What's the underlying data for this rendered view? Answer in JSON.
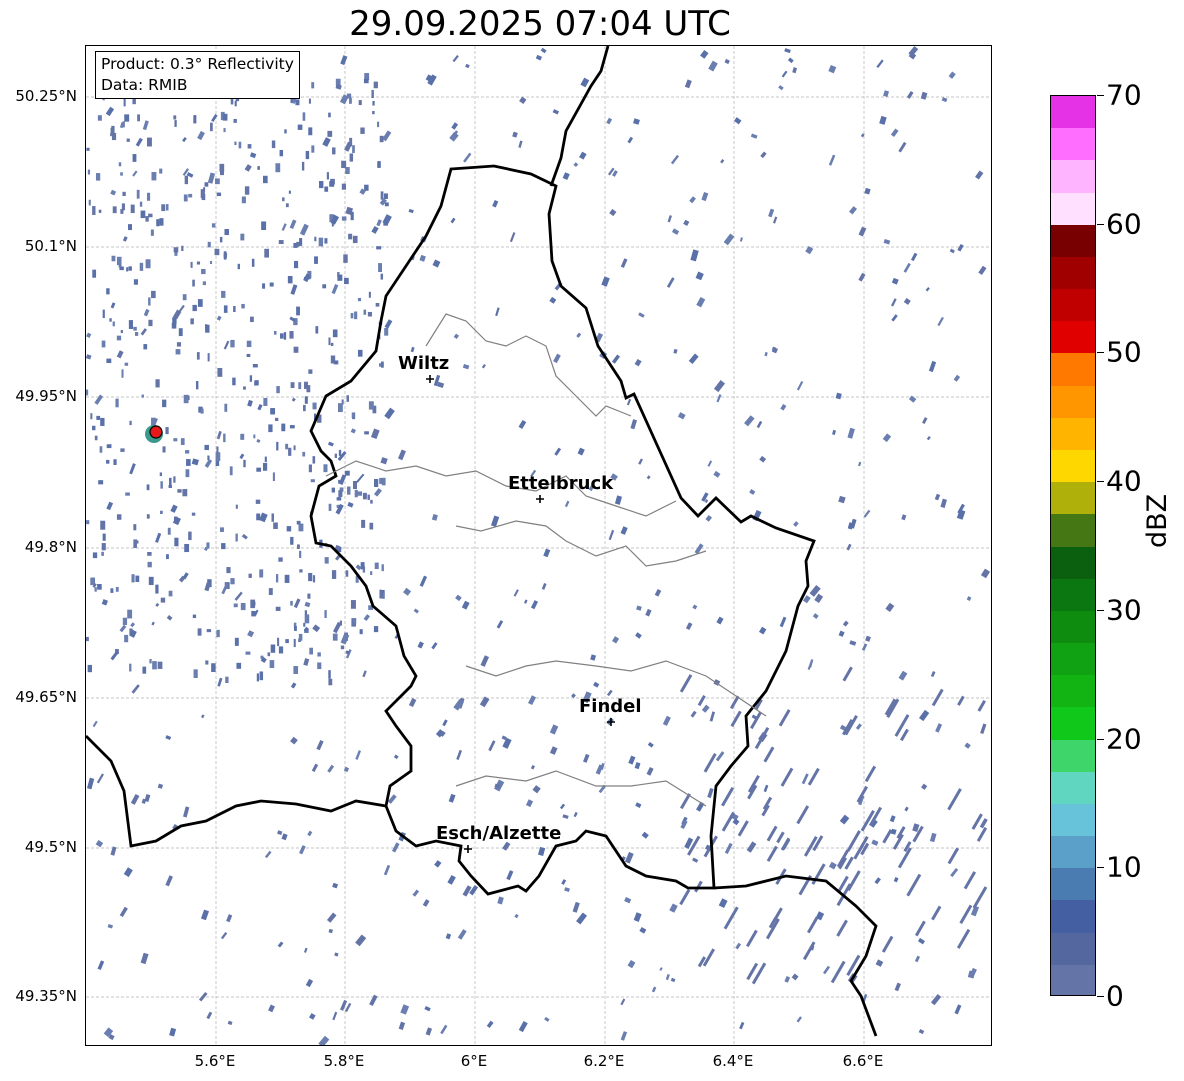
{
  "title": "29.09.2025 07:04 UTC",
  "info": {
    "product": "Product: 0.3° Reflectivity",
    "data_source": "Data: RMIB"
  },
  "lat_ticks": [
    "50.25°N",
    "50.1°N",
    "49.95°N",
    "49.8°N",
    "49.65°N",
    "49.5°N",
    "49.35°N"
  ],
  "lon_ticks": [
    "5.6°E",
    "5.8°E",
    "6°E",
    "6.2°E",
    "6.4°E",
    "6.6°E"
  ],
  "cities": [
    {
      "name": "Wiltz"
    },
    {
      "name": "Ettelbruck"
    },
    {
      "name": "Findel"
    },
    {
      "name": "Esch/Alzette"
    }
  ],
  "colorbar": {
    "label": "dBZ",
    "min": 0,
    "max": 70,
    "ticks": [
      "0",
      "10",
      "20",
      "30",
      "40",
      "50",
      "60",
      "70"
    ],
    "colors": [
      "#6474a6",
      "#54679e",
      "#4560a2",
      "#4a7cb1",
      "#5aa0c9",
      "#66c3d9",
      "#60d6c0",
      "#3ed66a",
      "#10c81a",
      "#12b414",
      "#10a212",
      "#0e8c10",
      "#0b7710",
      "#0a600f",
      "#457814",
      "#b0b00a",
      "#ffd700",
      "#ffb400",
      "#ff9600",
      "#ff7800",
      "#e10000",
      "#c00000",
      "#a00000",
      "#780000",
      "#ffe1ff",
      "#ffb4ff",
      "#ff6eff",
      "#e632e6"
    ]
  },
  "radar": {
    "station_color": "#e51919"
  }
}
